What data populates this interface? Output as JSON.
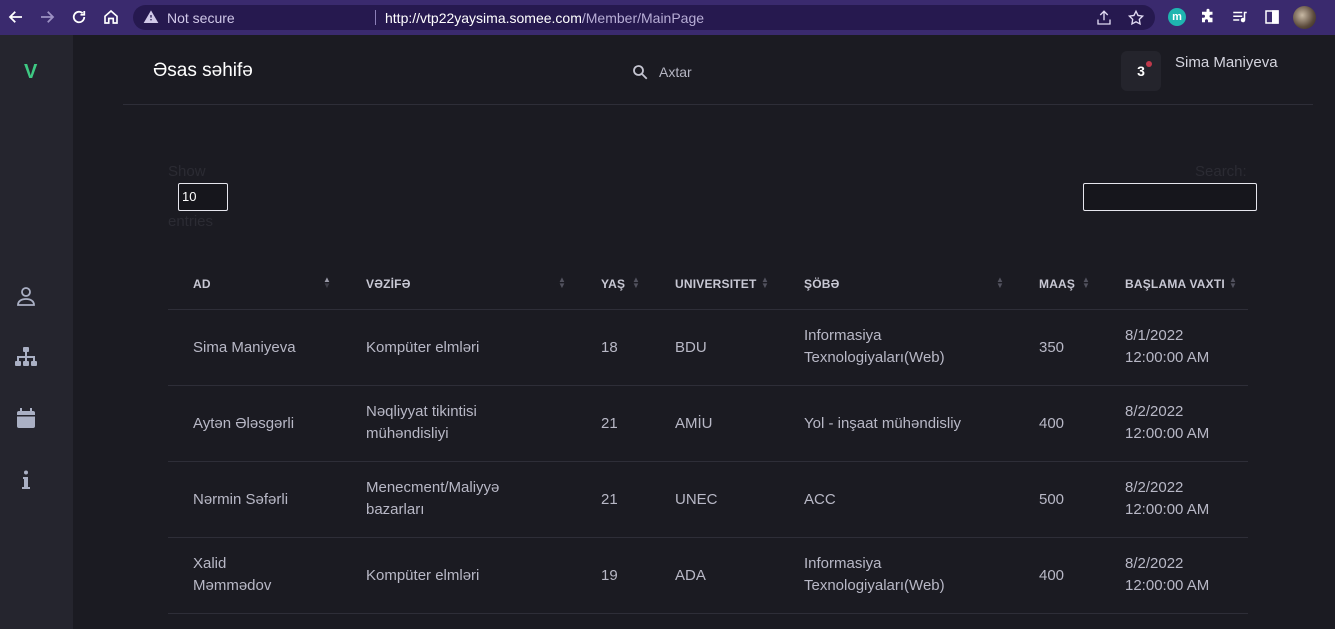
{
  "browser": {
    "security_label": "Not secure",
    "url_host": "http://vtp22yaysima.somee.com",
    "url_path": "/Member/MainPage",
    "extension_label": "m"
  },
  "sidebar": {
    "logo": "V",
    "items": [
      {
        "icon": "user-icon"
      },
      {
        "icon": "sitemap-icon"
      },
      {
        "icon": "calendar-icon"
      },
      {
        "icon": "info-icon"
      }
    ]
  },
  "header": {
    "title": "Əsas səhifə",
    "search_placeholder": "Axtar",
    "notification_count": "3",
    "user_name": "Sima Maniyeva"
  },
  "datatable": {
    "show_label": "Show",
    "entries_value": "10",
    "entries_label": "entries",
    "search_label": "Search:",
    "search_value": ""
  },
  "table": {
    "columns": [
      "AD",
      "VƏZİFƏ",
      "YAŞ",
      "UNIVERSITET",
      "ŞÖBƏ",
      "MAAŞ",
      "BAŞLAMA VAXTI"
    ],
    "rows": [
      {
        "ad": [
          "Sima Maniyeva"
        ],
        "vezife": [
          "Kompüter elmləri"
        ],
        "yas": "18",
        "universitet": "BDU",
        "sobe": [
          "Informasiya",
          "Texnologiyaları(Web)"
        ],
        "maas": "350",
        "baslama": [
          "8/1/2022",
          "12:00:00 AM"
        ]
      },
      {
        "ad": [
          "Aytən Ələsgərli"
        ],
        "vezife": [
          "Nəqliyyat tikintisi",
          "mühəndisliyi"
        ],
        "yas": "21",
        "universitet": "AMİU",
        "sobe": [
          "Yol - inşaat mühəndisliy"
        ],
        "maas": "400",
        "baslama": [
          "8/2/2022",
          "12:00:00 AM"
        ]
      },
      {
        "ad": [
          "Nərmin Səfərli"
        ],
        "vezife": [
          "Menecment/Maliyyə",
          "bazarları"
        ],
        "yas": "21",
        "universitet": "UNEC",
        "sobe": [
          "ACC"
        ],
        "maas": "500",
        "baslama": [
          "8/2/2022",
          "12:00:00 AM"
        ]
      },
      {
        "ad": [
          "Xalid",
          "Məmmədov"
        ],
        "vezife": [
          "Kompüter elmləri"
        ],
        "yas": "19",
        "universitet": "ADA",
        "sobe": [
          "Informasiya",
          "Texnologiyaları(Web)"
        ],
        "maas": "400",
        "baslama": [
          "8/2/2022",
          "12:00:00 AM"
        ]
      }
    ]
  },
  "colors": {
    "accent": "#3ec983",
    "browser_bar": "#3a2a6e",
    "background": "#1b1b22",
    "sidebar": "#25252e"
  }
}
